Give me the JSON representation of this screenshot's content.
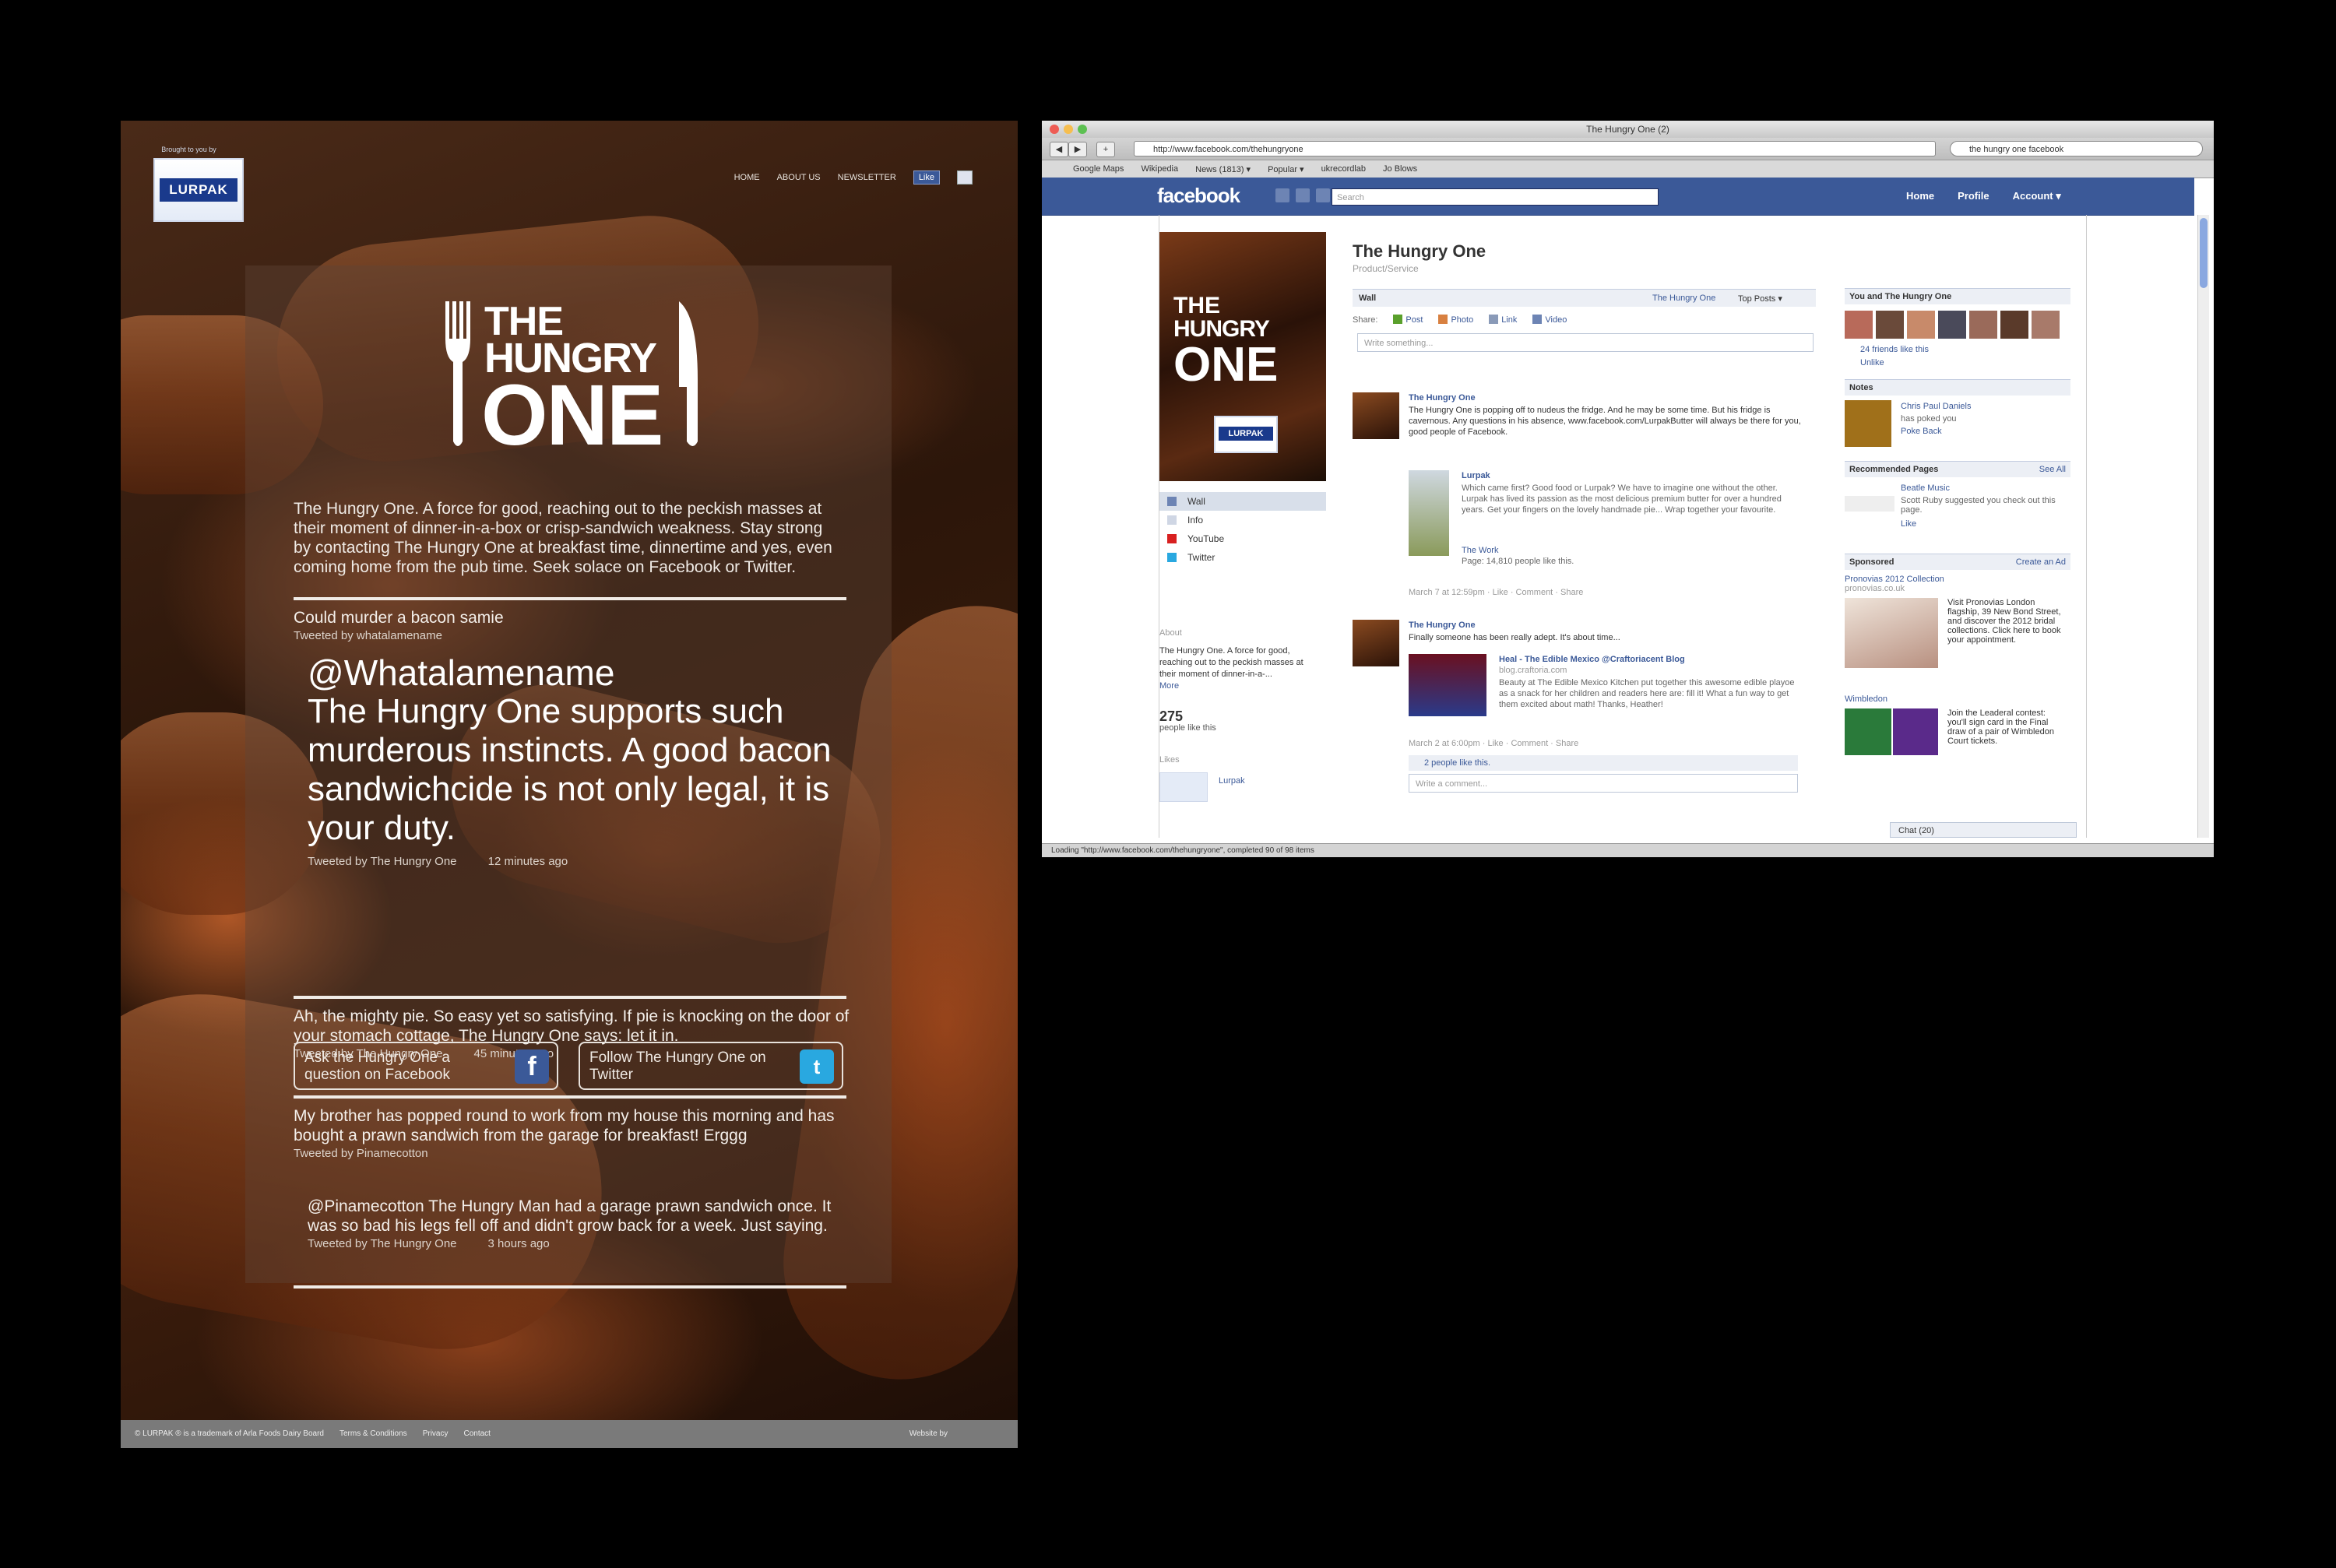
{
  "site": {
    "brand_tag": "Brought to you by",
    "brand_logo": "LURPAK",
    "nav": [
      "HOME",
      "ABOUT US",
      "NEWSLETTER"
    ],
    "like_label": "Like",
    "logo": {
      "line1": "THE",
      "line2": "HUNGRY",
      "line3": "ONE"
    },
    "intro": "The Hungry One. A force for good, reaching out to the peckish masses at their moment of dinner-in-a-box or crisp-sandwich weakness. Stay strong by contacting The Hungry One at breakfast time, dinnertime and yes, even coming home from the pub time. Seek solace on Facebook or Twitter.",
    "tweets": [
      {
        "text": "Could murder a bacon samie",
        "by": "Tweeted by whatalamename",
        "time": ""
      },
      {
        "text": "Ah, the mighty pie. So easy yet so satisfying. If pie is knocking on the door of your stomach cottage, The Hungry One says: let it in.",
        "by": "Tweeted by The Hungry One",
        "time": "45 minutes ago"
      },
      {
        "text": "My brother has popped round to work from my house this morning and has bought a prawn sandwich from the garage for breakfast! Erggg",
        "by": "Tweeted by Pinamecotton",
        "time": ""
      },
      {
        "text": "@Pinamecotton The Hungry Man had a garage prawn sandwich once. It was so bad his legs fell off and didn't grow back for a week. Just saying.",
        "by": "Tweeted by The Hungry One",
        "time": "3 hours ago"
      }
    ],
    "featured": {
      "handle": "@Whatalamename",
      "text": "The Hungry One supports such murderous instincts. A good bacon sandwichcide is not only legal, it is your duty.",
      "by": "Tweeted by The Hungry One",
      "time": "12 minutes ago"
    },
    "cta_facebook": "Ask the Hungry One a question on Facebook",
    "cta_twitter": "Follow The Hungry One on Twitter",
    "footer_links": [
      "© LURPAK ® is a trademark of Arla Foods Dairy Board",
      "Terms & Conditions",
      "Privacy",
      "Contact"
    ],
    "footer_right": "Website by"
  },
  "browser": {
    "title": "The Hungry One (2)",
    "url": "http://www.facebook.com/thehungryone",
    "google": "the hungry one facebook",
    "bookmarks": [
      "Google Maps",
      "Wikipedia",
      "News (1813) ▾",
      "Popular ▾",
      "ukrecordlab",
      "Jo Blows"
    ],
    "status": "Loading \"http://www.facebook.com/thehungryone\", completed 90 of 98 items"
  },
  "fb": {
    "logo": "facebook",
    "search_placeholder": "Search",
    "top_links": [
      "Home",
      "Profile",
      "Account ▾"
    ],
    "page_title": "The Hungry One",
    "page_sub": "Product/Service",
    "profile_logo": "LURPAK",
    "left_nav": [
      "Wall",
      "Info",
      "YouTube",
      "Twitter"
    ],
    "about_heading": "About",
    "about_text": "The Hungry One. A force for good, reaching out to the peckish masses at their moment of dinner-in-a-...",
    "about_more": "More",
    "likes_count": "275",
    "likes_label": "people like this",
    "likes_heading": "Likes",
    "likes_item": "Lurpak",
    "wall_label": "Wall",
    "wall_filter1": "The Hungry One",
    "wall_filter2": "Top Posts ▾",
    "share_label": "Share:",
    "share_items": [
      "Post",
      "Photo",
      "Link",
      "Video"
    ],
    "composer": "Write something...",
    "post1": {
      "name": "The Hungry One",
      "text": "The Hungry One is popping off to nudeus the fridge. And he may be some time. But his fridge is cavernous. Any questions in his absence, www.facebook.com/LurpakButter will always be there for you, good people of Facebook.",
      "attach_name": "Lurpak",
      "attach_text": "Which came first? Good food or Lurpak? We have to imagine one without the other. Lurpak has lived its passion as the most delicious premium butter for over a hundred years. Get your fingers on the lovely handmade pie... Wrap together your favourite.",
      "attach_sub": "The Work",
      "attach_count": "Page: 14,810 people like this.",
      "meta": "March 7 at 12:59pm · Like · Comment · Share"
    },
    "post2": {
      "name": "The Hungry One",
      "text": "Finally someone has been really adept. It's about time...",
      "attach_name": "Heal - The Edible Mexico @Craftoriacent Blog",
      "attach_domain": "blog.craftoria.com",
      "attach_text": "Beauty at The Edible Mexico Kitchen put together this awesome edible playoe as a snack for her children and readers here are: fill it! What a fun way to get them excited about math! Thanks, Heather!",
      "meta": "March 2 at 6:00pm · Like · Comment · Share",
      "likes": "2 people like this.",
      "comment_placeholder": "Write a comment..."
    },
    "right": {
      "you_heading": "You and The Hungry One",
      "friends": "24 friends like this",
      "unlike": "Unlike",
      "notes_heading": "Notes",
      "note_name": "Chris Paul Daniels",
      "note_sub": "has poked you",
      "note_link": "Poke Back",
      "rec_heading": "Recommended Pages",
      "see_all": "See All",
      "rec_name": "Beatle Music",
      "rec_text": "Scott Ruby suggested you check out this page.",
      "rec_like": "Like",
      "sponsored_heading": "Sponsored",
      "create_ad": "Create an Ad",
      "ad_title": "Pronovias 2012 Collection",
      "ad_domain": "pronovias.co.uk",
      "ad_text": "Visit Pronovias London flagship, 39 New Bond Street, and discover the 2012 bridal collections. Click here to book your appointment.",
      "ad2_title": "Wimbledon",
      "ad2_text": "Join the Leaderal contest: you'll sign card in the Final draw of a pair of Wimbledon Court tickets.",
      "chat": "Chat (20)"
    }
  }
}
